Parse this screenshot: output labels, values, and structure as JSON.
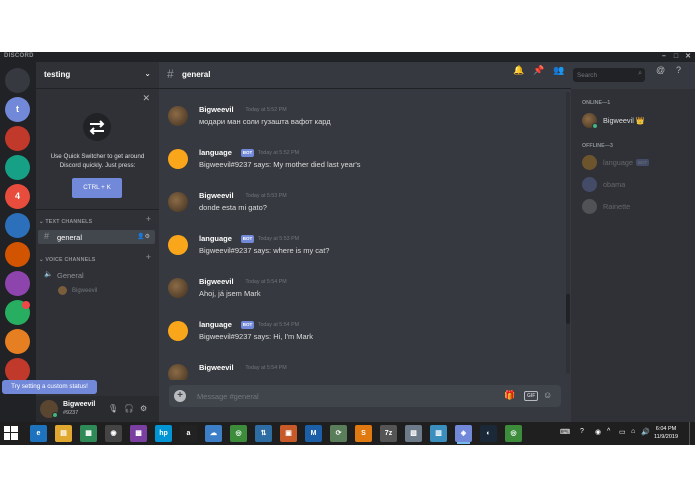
{
  "window": {
    "brand": "DISCORD",
    "minimize": "–",
    "maximize": "□",
    "close": "✕"
  },
  "guilds": [
    {
      "name": "home",
      "label": "",
      "color": "#36393f"
    },
    {
      "name": "testing",
      "label": "t",
      "color": "#7289da"
    },
    {
      "name": "server-2",
      "label": "",
      "color": "#c0392b"
    },
    {
      "name": "server-3",
      "label": "",
      "color": "#16a085"
    },
    {
      "name": "server-4",
      "label": "4",
      "color": "#e74c3c"
    },
    {
      "name": "server-5",
      "label": "",
      "color": "#2c6fbb"
    },
    {
      "name": "server-6",
      "label": "",
      "color": "#d35400"
    },
    {
      "name": "server-7",
      "label": "",
      "color": "#8e44ad"
    },
    {
      "name": "server-8",
      "label": "",
      "color": "#27ae60"
    },
    {
      "name": "server-9",
      "label": "",
      "color": "#e67e22"
    },
    {
      "name": "server-10",
      "label": "",
      "color": "#c0392b"
    }
  ],
  "server": {
    "name": "testing"
  },
  "quick_switcher": {
    "text": "Use Quick Switcher to get around Discord quickly. Just press:",
    "button": "CTRL + K"
  },
  "sidebar": {
    "text_category": "TEXT CHANNELS",
    "voice_category": "VOICE CHANNELS",
    "text_channels": [
      {
        "name": "general"
      }
    ],
    "voice_channels": [
      {
        "name": "General",
        "users": [
          "Bigweevil"
        ]
      }
    ]
  },
  "user_panel": {
    "name": "Bigweevil",
    "tag": "#9237",
    "tooltip": "Try setting a custom status!"
  },
  "chat": {
    "channel": "general",
    "messages": [
      {
        "author": "Bigweevil",
        "bot": false,
        "time": "Today at 5:52 PM",
        "content": "модари ман соли гузашта вафот кард"
      },
      {
        "author": "language",
        "bot": true,
        "time": "Today at 5:52 PM",
        "content": "Bigweevil#9237 says: My mother died last year's"
      },
      {
        "author": "Bigweevil",
        "bot": false,
        "time": "Today at 5:53 PM",
        "content": "donde esta mi gato?"
      },
      {
        "author": "language",
        "bot": true,
        "time": "Today at 5:53 PM",
        "content": "Bigweevil#9237 says: where is my cat?"
      },
      {
        "author": "Bigweevil",
        "bot": false,
        "time": "Today at 5:54 PM",
        "content": "Ahoj, já jsem Mark"
      },
      {
        "author": "language",
        "bot": true,
        "time": "Today at 5:54 PM",
        "content": "Bigweevil#9237 says: Hi, I'm Mark"
      },
      {
        "author": "Bigweevil",
        "bot": false,
        "time": "Today at 5:54 PM",
        "content": ""
      }
    ],
    "bot_tag": "BOT",
    "composer_placeholder": "Message #general",
    "gif_label": "GIF"
  },
  "header": {
    "search_placeholder": "Search"
  },
  "members": {
    "online_label": "ONLINE—1",
    "offline_label": "OFFLINE—3",
    "online": [
      {
        "name": "Bigweevil",
        "crown": "👑"
      }
    ],
    "offline": [
      {
        "name": "language",
        "bot": true
      },
      {
        "name": "obama",
        "bot": false
      },
      {
        "name": "Rainette",
        "bot": false
      }
    ]
  },
  "taskbar": {
    "time": "6:04 PM",
    "date": "11/9/2019",
    "apps": [
      {
        "name": "edge",
        "label": "e",
        "color": "#1e73be"
      },
      {
        "name": "file-explorer",
        "label": "▤",
        "color": "#e0a82e"
      },
      {
        "name": "store",
        "label": "▦",
        "color": "#2e8b57"
      },
      {
        "name": "camera",
        "label": "◉",
        "color": "#444444"
      },
      {
        "name": "photos",
        "label": "▩",
        "color": "#7a3fa0"
      },
      {
        "name": "hp",
        "label": "hp",
        "color": "#0096d6"
      },
      {
        "name": "amazon",
        "label": "a",
        "color": "#222222"
      },
      {
        "name": "weather",
        "label": "☁",
        "color": "#3d7fc7"
      },
      {
        "name": "chrome",
        "label": "◎",
        "color": "#3c8c3c"
      },
      {
        "name": "network",
        "label": "⇅",
        "color": "#2d6da3"
      },
      {
        "name": "app-11",
        "label": "▣",
        "color": "#c85a2a"
      },
      {
        "name": "malwarebytes",
        "label": "M",
        "color": "#1b5fa8"
      },
      {
        "name": "app-13",
        "label": "⟳",
        "color": "#5a7d5a"
      },
      {
        "name": "sublime",
        "label": "S",
        "color": "#e07a10"
      },
      {
        "name": "7zip",
        "label": "7z",
        "color": "#555555"
      },
      {
        "name": "app-16",
        "label": "▧",
        "color": "#6c7a89"
      },
      {
        "name": "app-17",
        "label": "▥",
        "color": "#3a8fbf"
      },
      {
        "name": "discord",
        "label": "◈",
        "color": "#7289da"
      },
      {
        "name": "steam",
        "label": "◐",
        "color": "#1b2838"
      },
      {
        "name": "chrome-2",
        "label": "◎",
        "color": "#3c8c3c"
      }
    ]
  }
}
